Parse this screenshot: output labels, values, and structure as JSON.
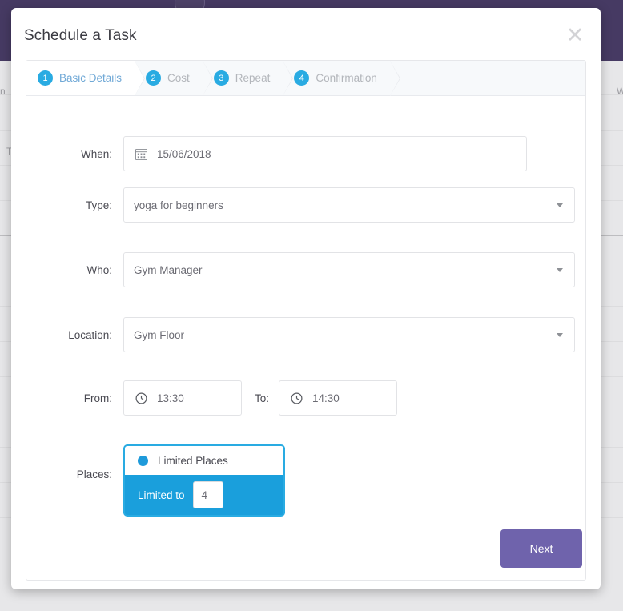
{
  "background": {
    "left_texts": [
      "n",
      "T"
    ],
    "right_texts": [
      "W"
    ]
  },
  "modal": {
    "title": "Schedule a Task",
    "close_label": "✕"
  },
  "stepper": {
    "steps": [
      {
        "number": "1",
        "label": "Basic Details",
        "active": true
      },
      {
        "number": "2",
        "label": "Cost",
        "active": false
      },
      {
        "number": "3",
        "label": "Repeat",
        "active": false
      },
      {
        "number": "4",
        "label": "Confirmation",
        "active": false
      }
    ]
  },
  "form": {
    "when": {
      "label": "When:",
      "value": "15/06/2018",
      "icon": "calendar-icon"
    },
    "type": {
      "label": "Type:",
      "value": "yoga for beginners"
    },
    "who": {
      "label": "Who:",
      "value": "Gym Manager"
    },
    "location": {
      "label": "Location:",
      "value": "Gym Floor"
    },
    "from": {
      "label": "From:",
      "value": "13:30",
      "icon": "clock-icon"
    },
    "to": {
      "label": "To:",
      "value": "14:30",
      "icon": "clock-icon"
    },
    "places": {
      "label": "Places:",
      "option_label": "Limited Places",
      "limit_label": "Limited to",
      "limit_value": "4"
    }
  },
  "footer": {
    "next_label": "Next"
  },
  "colors": {
    "accent_blue": "#29abe2",
    "places_blue": "#1a9fdc",
    "next_purple": "#6f63ac",
    "topbar_purple": "#463a63",
    "step_active_text": "#6fa8d6",
    "step_inactive_text": "#b3b6bb"
  }
}
